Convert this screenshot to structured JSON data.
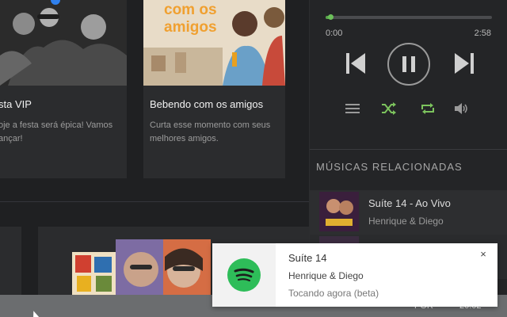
{
  "cards": [
    {
      "title": "sta VIP",
      "description": "oje a festa será épica! Vamos\nançar!",
      "image": "party-people-image"
    },
    {
      "title": "Bebendo com os amigos",
      "description": "Curta esse momento com seus melhores amigos.",
      "image": "friends-drinking-image",
      "overlay_text": "com os\namigos"
    }
  ],
  "player": {
    "time_current": "0:00",
    "time_duration": "2:58",
    "progress_percent": 3,
    "controls": {
      "prev_icon": "skip-back-icon",
      "play_pause_icon": "pause-icon",
      "next_icon": "skip-forward-icon",
      "queue_icon": "queue-icon",
      "shuffle_icon": "shuffle-icon",
      "repeat_icon": "repeat-icon",
      "volume_icon": "volume-icon"
    },
    "accent_color": "#58a54a"
  },
  "related": {
    "title": "MÚSICAS RELACIONADAS",
    "items": [
      {
        "name": "Suíte 14 - Ao Vivo",
        "artist": "Henrique & Diego"
      }
    ]
  },
  "notification": {
    "title": "Suíte 14",
    "artist": "Henrique & Diego",
    "status": "Tocando agora (beta)",
    "close": "×",
    "brand_color": "#2ebd59"
  },
  "taskbar": {
    "language": "POR",
    "clock": "20:02"
  }
}
